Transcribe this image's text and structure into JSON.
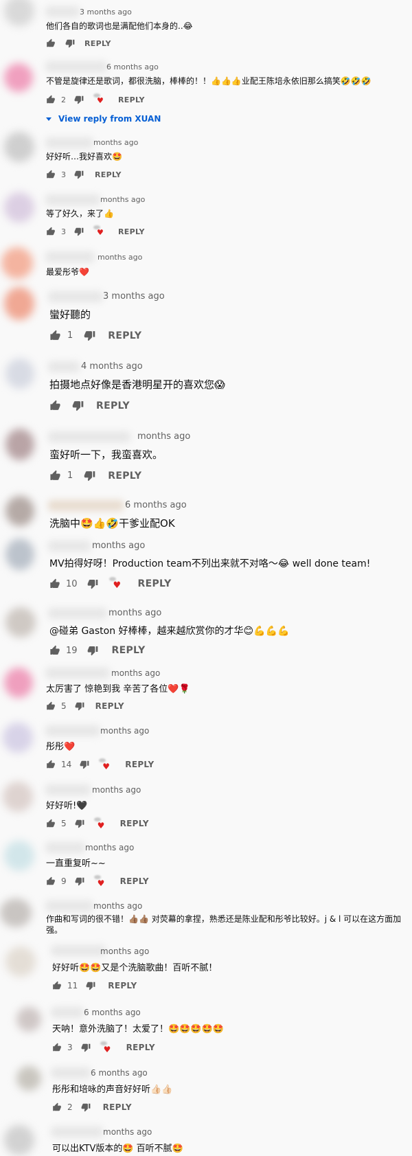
{
  "comments": [
    {
      "time": "3 months ago",
      "text": "他们各自的歌词也是满配他们本身的..😂",
      "likes": "",
      "reply": "REPLY",
      "hearted": false
    },
    {
      "time": "6 months ago",
      "text": "不管是旋律还是歌词，都很洗脑，棒棒的！！👍👍👍业配王陈培永依旧那么搞笑🤣🤣🤣",
      "likes": "2",
      "reply": "REPLY",
      "hearted": true,
      "view_reply": "View reply from XUAN"
    },
    {
      "time": "months ago",
      "text": "好好听…我好喜欢🤩",
      "likes": "3",
      "reply": "REPLY",
      "hearted": false
    },
    {
      "time": "months ago",
      "text": "等了好久，来了👍",
      "likes": "3",
      "reply": "REPLY",
      "hearted": true
    },
    {
      "time": "months ago",
      "text": "最爱彤爷❤️",
      "likes": "",
      "reply": "",
      "hearted": false
    },
    {
      "time": "3 months ago",
      "text": "蠻好聽的",
      "likes": "1",
      "reply": "REPLY",
      "hearted": false
    },
    {
      "time": "4 months ago",
      "text": "拍摄地点好像是香港明星开的喜欢您😱",
      "likes": "",
      "reply": "REPLY",
      "hearted": false
    },
    {
      "time": "months ago",
      "text": "蛮好听一下，我蛮喜欢。",
      "likes": "1",
      "reply": "REPLY",
      "hearted": false
    },
    {
      "time": "6 months ago",
      "text": "洗脑中🤩👍🤣干爹业配OK",
      "likes": "",
      "reply": "",
      "hearted": false
    },
    {
      "time": "months ago",
      "text": "MV拍得好呀！Production team不列出来就不对咯～😂 well done team!",
      "likes": "10",
      "reply": "REPLY",
      "hearted": true
    },
    {
      "time": "months ago",
      "text": "@碰弟 Gaston 好棒棒，越来越欣赏你的才华😊💪💪💪",
      "likes": "19",
      "reply": "REPLY",
      "hearted": false
    },
    {
      "time": "months ago",
      "text": "太厉害了 惊艳到我 辛苦了各位❤️🌹",
      "likes": "5",
      "reply": "REPLY",
      "hearted": false
    },
    {
      "time": "months ago",
      "text": "彤彤❤️",
      "likes": "14",
      "reply": "REPLY",
      "hearted": true
    },
    {
      "time": "months ago",
      "text": "好好听!🖤",
      "likes": "5",
      "reply": "REPLY",
      "hearted": true
    },
    {
      "time": "months ago",
      "text": "一直重复听~~",
      "likes": "9",
      "reply": "REPLY",
      "hearted": true
    },
    {
      "time": "months ago",
      "text": "作曲和写词的很不错！👍🏽👍🏽 对荧幕的拿捏，熟悉还是陈业配和彤爷比较好。j & l 可以在这方面加强。",
      "likes": "",
      "reply": "",
      "hearted": false
    },
    {
      "time": "months ago",
      "text": "好好听🤩🤩又是个洗脑歌曲！百听不腻！",
      "likes": "11",
      "reply": "REPLY",
      "hearted": false
    },
    {
      "time": "6 months ago",
      "text": "天呐！意外洗脑了！太爱了！🤩🤩🤩🤩🤩",
      "likes": "3",
      "reply": "REPLY",
      "hearted": true
    },
    {
      "time": "6 months ago",
      "text": "彤彤和培咏的声音好好听👍🏻👍🏻",
      "likes": "2",
      "reply": "REPLY",
      "hearted": false
    },
    {
      "time": "months ago",
      "text": "可以出KTV版本的🤩 百听不腻🤩",
      "likes": "",
      "reply": "",
      "hearted": false
    }
  ],
  "colors": {
    "link": "#065fd4",
    "heart": "#e02020",
    "meta": "#606060",
    "background": "#f9f9f9"
  },
  "icons": {
    "like": "thumb-up-icon",
    "dislike": "thumb-down-icon",
    "expand": "triangle-down-icon"
  }
}
